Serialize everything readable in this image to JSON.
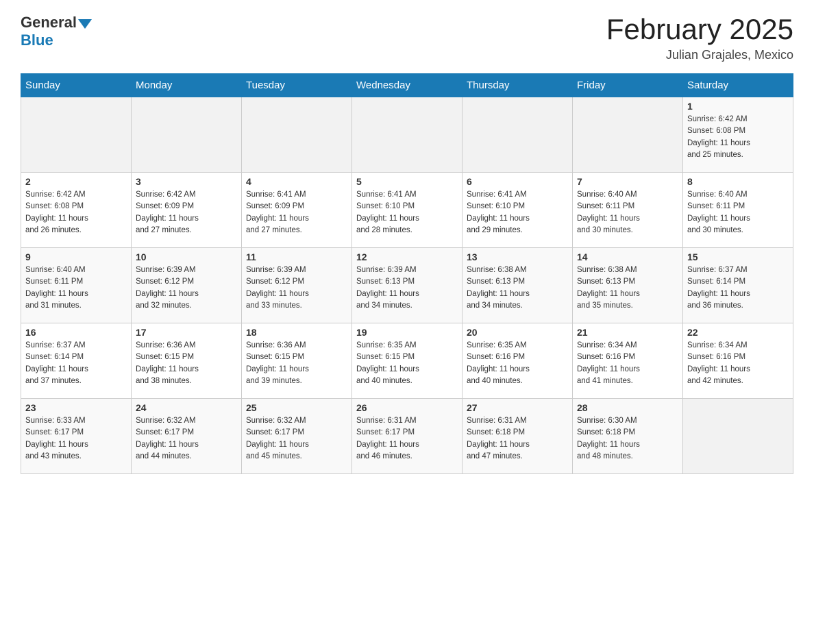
{
  "header": {
    "logo_general": "General",
    "logo_blue": "Blue",
    "title": "February 2025",
    "location": "Julian Grajales, Mexico"
  },
  "days_of_week": [
    "Sunday",
    "Monday",
    "Tuesday",
    "Wednesday",
    "Thursday",
    "Friday",
    "Saturday"
  ],
  "weeks": [
    [
      {
        "day": "",
        "info": ""
      },
      {
        "day": "",
        "info": ""
      },
      {
        "day": "",
        "info": ""
      },
      {
        "day": "",
        "info": ""
      },
      {
        "day": "",
        "info": ""
      },
      {
        "day": "",
        "info": ""
      },
      {
        "day": "1",
        "info": "Sunrise: 6:42 AM\nSunset: 6:08 PM\nDaylight: 11 hours\nand 25 minutes."
      }
    ],
    [
      {
        "day": "2",
        "info": "Sunrise: 6:42 AM\nSunset: 6:08 PM\nDaylight: 11 hours\nand 26 minutes."
      },
      {
        "day": "3",
        "info": "Sunrise: 6:42 AM\nSunset: 6:09 PM\nDaylight: 11 hours\nand 27 minutes."
      },
      {
        "day": "4",
        "info": "Sunrise: 6:41 AM\nSunset: 6:09 PM\nDaylight: 11 hours\nand 27 minutes."
      },
      {
        "day": "5",
        "info": "Sunrise: 6:41 AM\nSunset: 6:10 PM\nDaylight: 11 hours\nand 28 minutes."
      },
      {
        "day": "6",
        "info": "Sunrise: 6:41 AM\nSunset: 6:10 PM\nDaylight: 11 hours\nand 29 minutes."
      },
      {
        "day": "7",
        "info": "Sunrise: 6:40 AM\nSunset: 6:11 PM\nDaylight: 11 hours\nand 30 minutes."
      },
      {
        "day": "8",
        "info": "Sunrise: 6:40 AM\nSunset: 6:11 PM\nDaylight: 11 hours\nand 30 minutes."
      }
    ],
    [
      {
        "day": "9",
        "info": "Sunrise: 6:40 AM\nSunset: 6:11 PM\nDaylight: 11 hours\nand 31 minutes."
      },
      {
        "day": "10",
        "info": "Sunrise: 6:39 AM\nSunset: 6:12 PM\nDaylight: 11 hours\nand 32 minutes."
      },
      {
        "day": "11",
        "info": "Sunrise: 6:39 AM\nSunset: 6:12 PM\nDaylight: 11 hours\nand 33 minutes."
      },
      {
        "day": "12",
        "info": "Sunrise: 6:39 AM\nSunset: 6:13 PM\nDaylight: 11 hours\nand 34 minutes."
      },
      {
        "day": "13",
        "info": "Sunrise: 6:38 AM\nSunset: 6:13 PM\nDaylight: 11 hours\nand 34 minutes."
      },
      {
        "day": "14",
        "info": "Sunrise: 6:38 AM\nSunset: 6:13 PM\nDaylight: 11 hours\nand 35 minutes."
      },
      {
        "day": "15",
        "info": "Sunrise: 6:37 AM\nSunset: 6:14 PM\nDaylight: 11 hours\nand 36 minutes."
      }
    ],
    [
      {
        "day": "16",
        "info": "Sunrise: 6:37 AM\nSunset: 6:14 PM\nDaylight: 11 hours\nand 37 minutes."
      },
      {
        "day": "17",
        "info": "Sunrise: 6:36 AM\nSunset: 6:15 PM\nDaylight: 11 hours\nand 38 minutes."
      },
      {
        "day": "18",
        "info": "Sunrise: 6:36 AM\nSunset: 6:15 PM\nDaylight: 11 hours\nand 39 minutes."
      },
      {
        "day": "19",
        "info": "Sunrise: 6:35 AM\nSunset: 6:15 PM\nDaylight: 11 hours\nand 40 minutes."
      },
      {
        "day": "20",
        "info": "Sunrise: 6:35 AM\nSunset: 6:16 PM\nDaylight: 11 hours\nand 40 minutes."
      },
      {
        "day": "21",
        "info": "Sunrise: 6:34 AM\nSunset: 6:16 PM\nDaylight: 11 hours\nand 41 minutes."
      },
      {
        "day": "22",
        "info": "Sunrise: 6:34 AM\nSunset: 6:16 PM\nDaylight: 11 hours\nand 42 minutes."
      }
    ],
    [
      {
        "day": "23",
        "info": "Sunrise: 6:33 AM\nSunset: 6:17 PM\nDaylight: 11 hours\nand 43 minutes."
      },
      {
        "day": "24",
        "info": "Sunrise: 6:32 AM\nSunset: 6:17 PM\nDaylight: 11 hours\nand 44 minutes."
      },
      {
        "day": "25",
        "info": "Sunrise: 6:32 AM\nSunset: 6:17 PM\nDaylight: 11 hours\nand 45 minutes."
      },
      {
        "day": "26",
        "info": "Sunrise: 6:31 AM\nSunset: 6:17 PM\nDaylight: 11 hours\nand 46 minutes."
      },
      {
        "day": "27",
        "info": "Sunrise: 6:31 AM\nSunset: 6:18 PM\nDaylight: 11 hours\nand 47 minutes."
      },
      {
        "day": "28",
        "info": "Sunrise: 6:30 AM\nSunset: 6:18 PM\nDaylight: 11 hours\nand 48 minutes."
      },
      {
        "day": "",
        "info": ""
      }
    ]
  ]
}
